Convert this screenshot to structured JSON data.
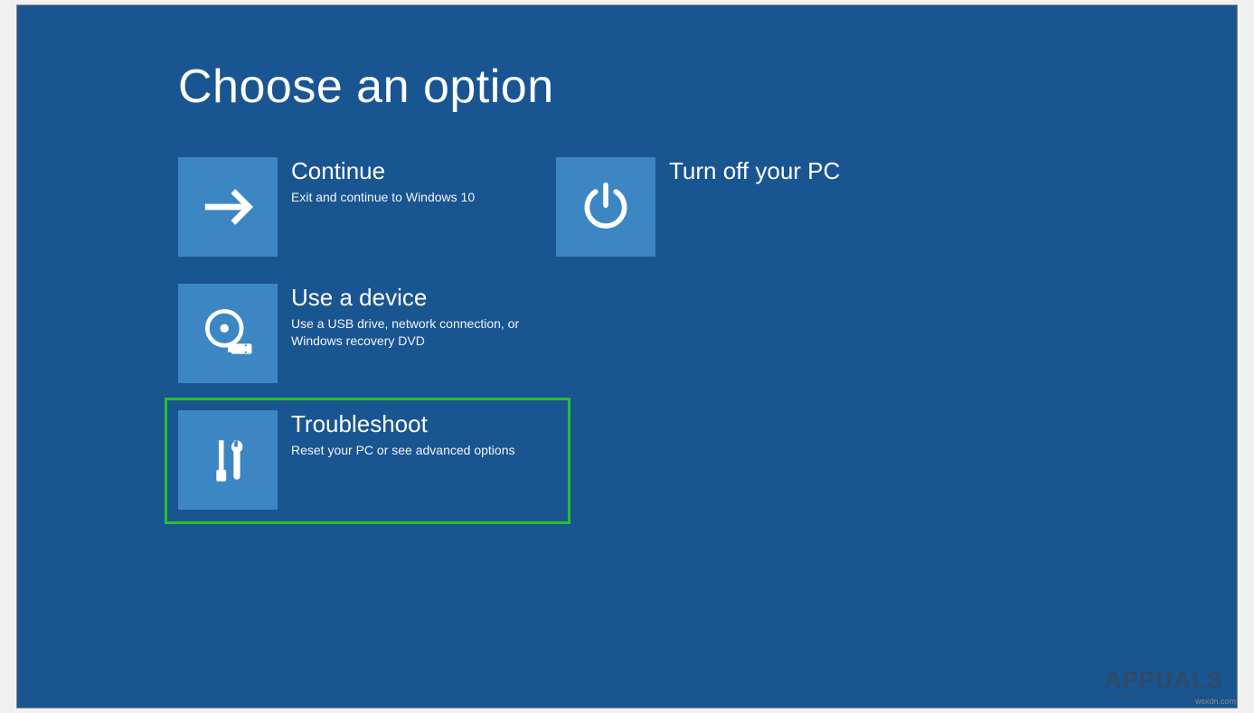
{
  "page": {
    "title": "Choose an option"
  },
  "options": {
    "continue": {
      "title": "Continue",
      "desc": "Exit and continue to Windows 10"
    },
    "turn_off": {
      "title": "Turn off your PC",
      "desc": ""
    },
    "use_device": {
      "title": "Use a device",
      "desc": "Use a USB drive, network connection, or Windows recovery DVD"
    },
    "troubleshoot": {
      "title": "Troubleshoot",
      "desc": "Reset your PC or see advanced options"
    }
  },
  "colors": {
    "background": "#195591",
    "tile": "#3c86c4",
    "highlight": "#26c12a"
  },
  "watermark": {
    "brand": "APPUALS",
    "tag": "FROM THE EXPERTS",
    "src": "wsxdn.com"
  }
}
